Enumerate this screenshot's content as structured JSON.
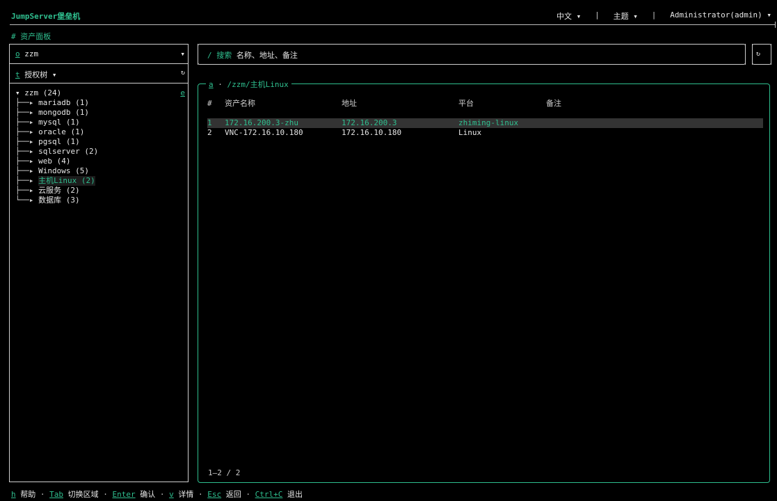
{
  "app": {
    "title": "JumpServer堡垒机"
  },
  "header": {
    "language": "中文",
    "theme": "主题",
    "user": "Administrator(admin)",
    "dropdown_glyph": "▾",
    "separator": "|"
  },
  "panel_title": "# 资产面板",
  "org_select": {
    "hotkey": "o",
    "value": "zzm",
    "arrow": "▾"
  },
  "tree_tab": {
    "hotkey": "t",
    "label": "授权树",
    "arrow": "▾",
    "refresh": "↻"
  },
  "tree": {
    "root": {
      "toggle": "▾",
      "label": "zzm (24)",
      "hotkey": "e"
    },
    "nodes": [
      {
        "conn": "├──▸ ",
        "label": "mariadb (1)"
      },
      {
        "conn": "├──▸ ",
        "label": "mongodb (1)"
      },
      {
        "conn": "├──▸ ",
        "label": "mysql (1)"
      },
      {
        "conn": "├──▸ ",
        "label": "oracle (1)"
      },
      {
        "conn": "├──▸ ",
        "label": "pgsql (1)"
      },
      {
        "conn": "├──▸ ",
        "label": "sqlserver (2)"
      },
      {
        "conn": "├──▸ ",
        "label": "web (4)"
      },
      {
        "conn": "├──▸ ",
        "label": "Windows (5)"
      },
      {
        "conn": "├──▸ ",
        "label": "主机Linux (2)",
        "active": true
      },
      {
        "conn": "├──▸ ",
        "label": "云服务 (2)"
      },
      {
        "conn": "└──▸ ",
        "label": "数据库 (3)"
      }
    ]
  },
  "search": {
    "prefix": "/ 搜索",
    "placeholder": "名称、地址、备注"
  },
  "refresh_button": "↻",
  "assets": {
    "hotkey": "a",
    "separator": " · ",
    "path": "/zzm/主机Linux",
    "columns": [
      "#",
      "资产名称",
      "地址",
      "平台",
      "备注"
    ],
    "rows": [
      {
        "idx": "1",
        "name": "172.16.200.3-zhu",
        "address": "172.16.200.3",
        "platform": "zhiming-linux",
        "note": ""
      },
      {
        "idx": "2",
        "name": "VNC-172.16.10.180",
        "address": "172.16.10.180",
        "platform": "Linux",
        "note": ""
      }
    ],
    "pager": "1–2 / 2"
  },
  "footer": [
    {
      "key": "h",
      "label": "帮助"
    },
    {
      "key": "Tab",
      "label": "切换区域"
    },
    {
      "key": "Enter",
      "label": "确认"
    },
    {
      "key": "v",
      "label": "详情"
    },
    {
      "key": "Esc",
      "label": "返回"
    },
    {
      "key": "Ctrl+C",
      "label": "退出"
    }
  ],
  "footer_sep": " · ",
  "colors": {
    "accent": "#2fbf8f",
    "background": "#000000",
    "text": "#e6e6e6",
    "selected_row": "#333333"
  }
}
